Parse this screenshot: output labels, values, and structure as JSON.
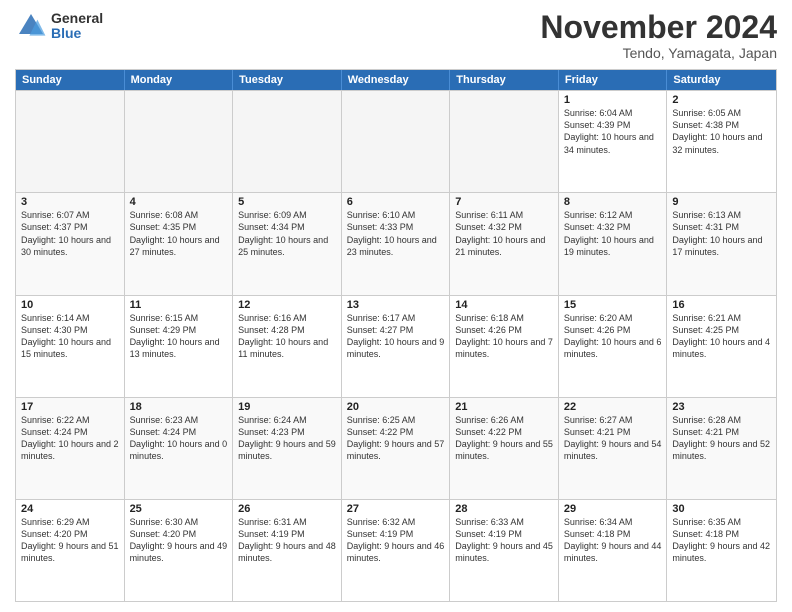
{
  "logo": {
    "general": "General",
    "blue": "Blue"
  },
  "title": "November 2024",
  "location": "Tendo, Yamagata, Japan",
  "weekdays": [
    "Sunday",
    "Monday",
    "Tuesday",
    "Wednesday",
    "Thursday",
    "Friday",
    "Saturday"
  ],
  "rows": [
    [
      {
        "day": "",
        "info": "",
        "empty": true
      },
      {
        "day": "",
        "info": "",
        "empty": true
      },
      {
        "day": "",
        "info": "",
        "empty": true
      },
      {
        "day": "",
        "info": "",
        "empty": true
      },
      {
        "day": "",
        "info": "",
        "empty": true
      },
      {
        "day": "1",
        "info": "Sunrise: 6:04 AM\nSunset: 4:39 PM\nDaylight: 10 hours and 34 minutes."
      },
      {
        "day": "2",
        "info": "Sunrise: 6:05 AM\nSunset: 4:38 PM\nDaylight: 10 hours and 32 minutes."
      }
    ],
    [
      {
        "day": "3",
        "info": "Sunrise: 6:07 AM\nSunset: 4:37 PM\nDaylight: 10 hours and 30 minutes."
      },
      {
        "day": "4",
        "info": "Sunrise: 6:08 AM\nSunset: 4:35 PM\nDaylight: 10 hours and 27 minutes."
      },
      {
        "day": "5",
        "info": "Sunrise: 6:09 AM\nSunset: 4:34 PM\nDaylight: 10 hours and 25 minutes."
      },
      {
        "day": "6",
        "info": "Sunrise: 6:10 AM\nSunset: 4:33 PM\nDaylight: 10 hours and 23 minutes."
      },
      {
        "day": "7",
        "info": "Sunrise: 6:11 AM\nSunset: 4:32 PM\nDaylight: 10 hours and 21 minutes."
      },
      {
        "day": "8",
        "info": "Sunrise: 6:12 AM\nSunset: 4:32 PM\nDaylight: 10 hours and 19 minutes."
      },
      {
        "day": "9",
        "info": "Sunrise: 6:13 AM\nSunset: 4:31 PM\nDaylight: 10 hours and 17 minutes."
      }
    ],
    [
      {
        "day": "10",
        "info": "Sunrise: 6:14 AM\nSunset: 4:30 PM\nDaylight: 10 hours and 15 minutes."
      },
      {
        "day": "11",
        "info": "Sunrise: 6:15 AM\nSunset: 4:29 PM\nDaylight: 10 hours and 13 minutes."
      },
      {
        "day": "12",
        "info": "Sunrise: 6:16 AM\nSunset: 4:28 PM\nDaylight: 10 hours and 11 minutes."
      },
      {
        "day": "13",
        "info": "Sunrise: 6:17 AM\nSunset: 4:27 PM\nDaylight: 10 hours and 9 minutes."
      },
      {
        "day": "14",
        "info": "Sunrise: 6:18 AM\nSunset: 4:26 PM\nDaylight: 10 hours and 7 minutes."
      },
      {
        "day": "15",
        "info": "Sunrise: 6:20 AM\nSunset: 4:26 PM\nDaylight: 10 hours and 6 minutes."
      },
      {
        "day": "16",
        "info": "Sunrise: 6:21 AM\nSunset: 4:25 PM\nDaylight: 10 hours and 4 minutes."
      }
    ],
    [
      {
        "day": "17",
        "info": "Sunrise: 6:22 AM\nSunset: 4:24 PM\nDaylight: 10 hours and 2 minutes."
      },
      {
        "day": "18",
        "info": "Sunrise: 6:23 AM\nSunset: 4:24 PM\nDaylight: 10 hours and 0 minutes."
      },
      {
        "day": "19",
        "info": "Sunrise: 6:24 AM\nSunset: 4:23 PM\nDaylight: 9 hours and 59 minutes."
      },
      {
        "day": "20",
        "info": "Sunrise: 6:25 AM\nSunset: 4:22 PM\nDaylight: 9 hours and 57 minutes."
      },
      {
        "day": "21",
        "info": "Sunrise: 6:26 AM\nSunset: 4:22 PM\nDaylight: 9 hours and 55 minutes."
      },
      {
        "day": "22",
        "info": "Sunrise: 6:27 AM\nSunset: 4:21 PM\nDaylight: 9 hours and 54 minutes."
      },
      {
        "day": "23",
        "info": "Sunrise: 6:28 AM\nSunset: 4:21 PM\nDaylight: 9 hours and 52 minutes."
      }
    ],
    [
      {
        "day": "24",
        "info": "Sunrise: 6:29 AM\nSunset: 4:20 PM\nDaylight: 9 hours and 51 minutes."
      },
      {
        "day": "25",
        "info": "Sunrise: 6:30 AM\nSunset: 4:20 PM\nDaylight: 9 hours and 49 minutes."
      },
      {
        "day": "26",
        "info": "Sunrise: 6:31 AM\nSunset: 4:19 PM\nDaylight: 9 hours and 48 minutes."
      },
      {
        "day": "27",
        "info": "Sunrise: 6:32 AM\nSunset: 4:19 PM\nDaylight: 9 hours and 46 minutes."
      },
      {
        "day": "28",
        "info": "Sunrise: 6:33 AM\nSunset: 4:19 PM\nDaylight: 9 hours and 45 minutes."
      },
      {
        "day": "29",
        "info": "Sunrise: 6:34 AM\nSunset: 4:18 PM\nDaylight: 9 hours and 44 minutes."
      },
      {
        "day": "30",
        "info": "Sunrise: 6:35 AM\nSunset: 4:18 PM\nDaylight: 9 hours and 42 minutes."
      }
    ]
  ]
}
